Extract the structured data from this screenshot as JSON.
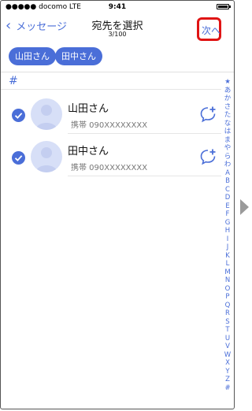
{
  "status": {
    "carrier": "●●●●● docomo  LTE",
    "time": "9:41"
  },
  "nav": {
    "back": "メッセージ",
    "title": "宛先を選択",
    "count": "3/100",
    "next": "次へ"
  },
  "chips": [
    "山田さん",
    "田中さん"
  ],
  "section": "#",
  "contacts": [
    {
      "name": "山田さん",
      "phone": "携帯 090XXXXXXXX",
      "checked": true
    },
    {
      "name": "田中さん",
      "phone": "携帯 090XXXXXXXX",
      "checked": true
    }
  ],
  "index": [
    "★",
    "あ",
    "か",
    "さ",
    "た",
    "な",
    "は",
    "ま",
    "や",
    "ら",
    "わ",
    "A",
    "B",
    "C",
    "D",
    "E",
    "F",
    "G",
    "H",
    "I",
    "J",
    "K",
    "L",
    "M",
    "N",
    "O",
    "P",
    "Q",
    "R",
    "S",
    "T",
    "U",
    "V",
    "W",
    "X",
    "Y",
    "Z",
    "#"
  ],
  "colors": {
    "accent": "#4a6ed8",
    "highlight": "#e01414",
    "avatar": "#d7dff7"
  }
}
